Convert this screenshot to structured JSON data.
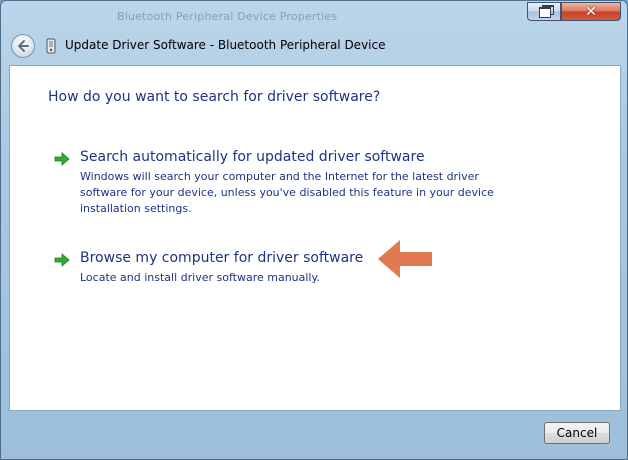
{
  "window": {
    "background_title": "Bluetooth Peripheral Device Properties",
    "restore_icon": "restore-icon",
    "close_icon": "close-icon",
    "close_glyph": "✕"
  },
  "nav": {
    "back_icon": "back-arrow-icon",
    "device_icon": "bluetooth-device-icon",
    "title": "Update Driver Software - Bluetooth Peripheral Device"
  },
  "main": {
    "heading": "How do you want to search for driver software?",
    "options": [
      {
        "icon": "green-arrow-icon",
        "title": "Search automatically for updated driver software",
        "description": "Windows will search your computer and the Internet for the latest driver software for your device, unless you've disabled this feature in your device installation settings."
      },
      {
        "icon": "green-arrow-icon",
        "title": "Browse my computer for driver software",
        "description": "Locate and install driver software manually."
      }
    ],
    "annotation_icon": "orange-pointer-arrow-icon"
  },
  "footer": {
    "cancel_label": "Cancel"
  },
  "colors": {
    "link_blue": "#1e3287",
    "green_arrow": "#2eae2e",
    "orange_arrow": "#e07a52",
    "close_red": "#c7442a"
  }
}
